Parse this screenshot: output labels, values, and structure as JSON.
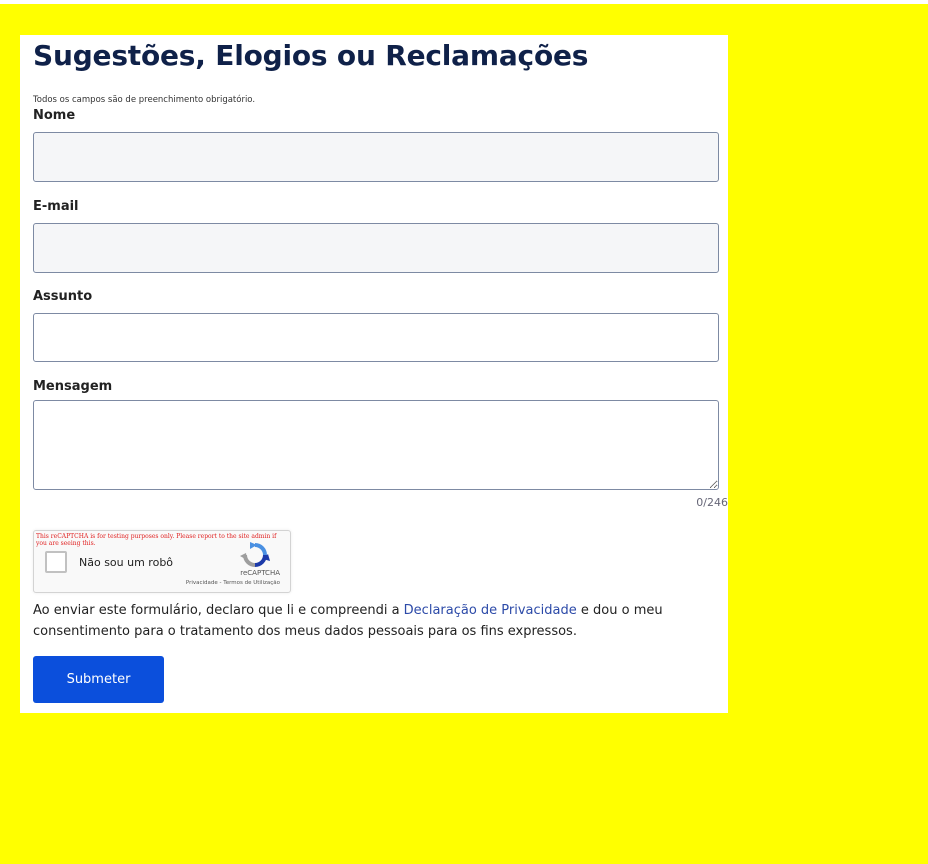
{
  "page": {
    "background_color": "#ffff00",
    "panel_color": "#ffffff",
    "accent_color": "#0b4fdc"
  },
  "form": {
    "title": "Sugestões, Elogios ou Reclamações",
    "required_note": "Todos os campos são de preenchimento obrigatório.",
    "fields": {
      "name_label": "Nome",
      "name_value": "",
      "email_label": "E-mail",
      "email_value": "",
      "subject_label": "Assunto",
      "subject_value": "",
      "message_label": "Mensagem",
      "message_value": "",
      "message_counter": "0/246"
    },
    "captcha": {
      "warning": "This reCAPTCHA is for testing purposes only. Please report to the site admin if you are seeing this.",
      "checkbox_label": "Não sou um robô",
      "brand": "reCAPTCHA",
      "privacy_link": "Privacidade",
      "separator": " - ",
      "terms_link": "Termos de Utilização",
      "checked": false,
      "icon": "recaptcha-logo-icon"
    },
    "consent": {
      "before": "Ao enviar este formulário, declaro que li e compreendi a ",
      "link": "Declaração de Privacidade",
      "after": " e dou o meu consentimento para o tratamento dos meus dados pessoais para os fins expressos."
    },
    "submit_label": "Submeter"
  }
}
